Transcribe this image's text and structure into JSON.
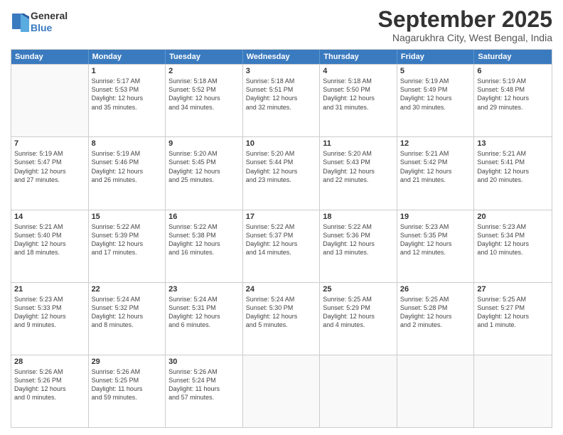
{
  "header": {
    "logo_line1": "General",
    "logo_line2": "Blue",
    "month": "September 2025",
    "location": "Nagarukhra City, West Bengal, India"
  },
  "weekdays": [
    "Sunday",
    "Monday",
    "Tuesday",
    "Wednesday",
    "Thursday",
    "Friday",
    "Saturday"
  ],
  "rows": [
    [
      {
        "day": "",
        "info": ""
      },
      {
        "day": "1",
        "info": "Sunrise: 5:17 AM\nSunset: 5:53 PM\nDaylight: 12 hours\nand 35 minutes."
      },
      {
        "day": "2",
        "info": "Sunrise: 5:18 AM\nSunset: 5:52 PM\nDaylight: 12 hours\nand 34 minutes."
      },
      {
        "day": "3",
        "info": "Sunrise: 5:18 AM\nSunset: 5:51 PM\nDaylight: 12 hours\nand 32 minutes."
      },
      {
        "day": "4",
        "info": "Sunrise: 5:18 AM\nSunset: 5:50 PM\nDaylight: 12 hours\nand 31 minutes."
      },
      {
        "day": "5",
        "info": "Sunrise: 5:19 AM\nSunset: 5:49 PM\nDaylight: 12 hours\nand 30 minutes."
      },
      {
        "day": "6",
        "info": "Sunrise: 5:19 AM\nSunset: 5:48 PM\nDaylight: 12 hours\nand 29 minutes."
      }
    ],
    [
      {
        "day": "7",
        "info": "Sunrise: 5:19 AM\nSunset: 5:47 PM\nDaylight: 12 hours\nand 27 minutes."
      },
      {
        "day": "8",
        "info": "Sunrise: 5:19 AM\nSunset: 5:46 PM\nDaylight: 12 hours\nand 26 minutes."
      },
      {
        "day": "9",
        "info": "Sunrise: 5:20 AM\nSunset: 5:45 PM\nDaylight: 12 hours\nand 25 minutes."
      },
      {
        "day": "10",
        "info": "Sunrise: 5:20 AM\nSunset: 5:44 PM\nDaylight: 12 hours\nand 23 minutes."
      },
      {
        "day": "11",
        "info": "Sunrise: 5:20 AM\nSunset: 5:43 PM\nDaylight: 12 hours\nand 22 minutes."
      },
      {
        "day": "12",
        "info": "Sunrise: 5:21 AM\nSunset: 5:42 PM\nDaylight: 12 hours\nand 21 minutes."
      },
      {
        "day": "13",
        "info": "Sunrise: 5:21 AM\nSunset: 5:41 PM\nDaylight: 12 hours\nand 20 minutes."
      }
    ],
    [
      {
        "day": "14",
        "info": "Sunrise: 5:21 AM\nSunset: 5:40 PM\nDaylight: 12 hours\nand 18 minutes."
      },
      {
        "day": "15",
        "info": "Sunrise: 5:22 AM\nSunset: 5:39 PM\nDaylight: 12 hours\nand 17 minutes."
      },
      {
        "day": "16",
        "info": "Sunrise: 5:22 AM\nSunset: 5:38 PM\nDaylight: 12 hours\nand 16 minutes."
      },
      {
        "day": "17",
        "info": "Sunrise: 5:22 AM\nSunset: 5:37 PM\nDaylight: 12 hours\nand 14 minutes."
      },
      {
        "day": "18",
        "info": "Sunrise: 5:22 AM\nSunset: 5:36 PM\nDaylight: 12 hours\nand 13 minutes."
      },
      {
        "day": "19",
        "info": "Sunrise: 5:23 AM\nSunset: 5:35 PM\nDaylight: 12 hours\nand 12 minutes."
      },
      {
        "day": "20",
        "info": "Sunrise: 5:23 AM\nSunset: 5:34 PM\nDaylight: 12 hours\nand 10 minutes."
      }
    ],
    [
      {
        "day": "21",
        "info": "Sunrise: 5:23 AM\nSunset: 5:33 PM\nDaylight: 12 hours\nand 9 minutes."
      },
      {
        "day": "22",
        "info": "Sunrise: 5:24 AM\nSunset: 5:32 PM\nDaylight: 12 hours\nand 8 minutes."
      },
      {
        "day": "23",
        "info": "Sunrise: 5:24 AM\nSunset: 5:31 PM\nDaylight: 12 hours\nand 6 minutes."
      },
      {
        "day": "24",
        "info": "Sunrise: 5:24 AM\nSunset: 5:30 PM\nDaylight: 12 hours\nand 5 minutes."
      },
      {
        "day": "25",
        "info": "Sunrise: 5:25 AM\nSunset: 5:29 PM\nDaylight: 12 hours\nand 4 minutes."
      },
      {
        "day": "26",
        "info": "Sunrise: 5:25 AM\nSunset: 5:28 PM\nDaylight: 12 hours\nand 2 minutes."
      },
      {
        "day": "27",
        "info": "Sunrise: 5:25 AM\nSunset: 5:27 PM\nDaylight: 12 hours\nand 1 minute."
      }
    ],
    [
      {
        "day": "28",
        "info": "Sunrise: 5:26 AM\nSunset: 5:26 PM\nDaylight: 12 hours\nand 0 minutes."
      },
      {
        "day": "29",
        "info": "Sunrise: 5:26 AM\nSunset: 5:25 PM\nDaylight: 11 hours\nand 59 minutes."
      },
      {
        "day": "30",
        "info": "Sunrise: 5:26 AM\nSunset: 5:24 PM\nDaylight: 11 hours\nand 57 minutes."
      },
      {
        "day": "",
        "info": ""
      },
      {
        "day": "",
        "info": ""
      },
      {
        "day": "",
        "info": ""
      },
      {
        "day": "",
        "info": ""
      }
    ]
  ]
}
